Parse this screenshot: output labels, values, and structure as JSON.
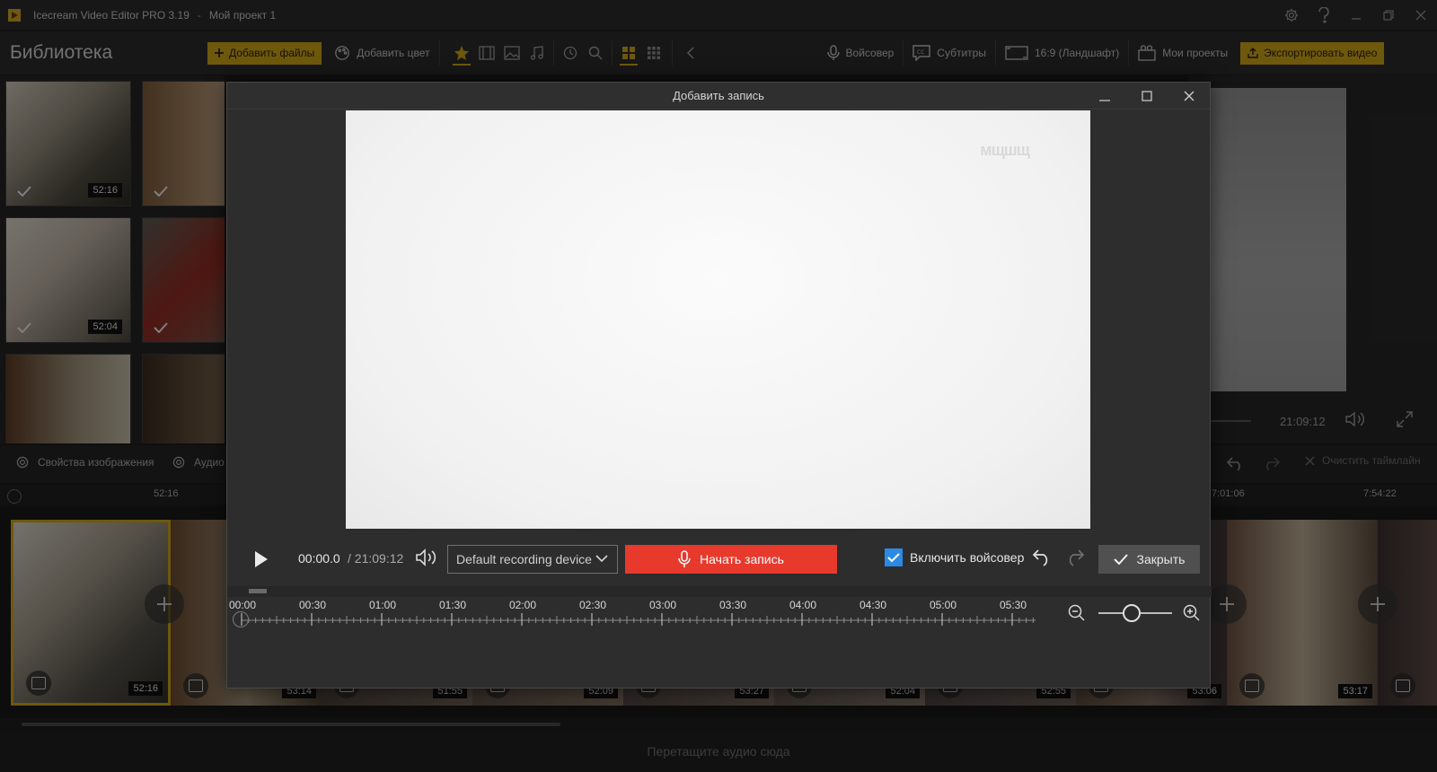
{
  "titlebar": {
    "app": "Icecream Video Editor PRO 3.19",
    "sep": "-",
    "project": "Мой проект 1"
  },
  "toolbar": {
    "library_title": "Библиотека",
    "add_files": "Добавить файлы",
    "add_color": "Добавить цвет",
    "voiceover": "Войсовер",
    "subtitles": "Субтитры",
    "aspect": "16:9 (Ландшафт)",
    "my_projects": "Мои проекты",
    "export": "Экспортировать видео"
  },
  "library": {
    "thumbs": [
      {
        "duration": "52:16"
      },
      {
        "duration": "52:04"
      }
    ]
  },
  "preview": {
    "time": "21:09:12"
  },
  "props": {
    "image_props": "Свойства изображения",
    "audio": "Аудио",
    "clear_timeline": "Очистить таймлайн"
  },
  "timeline": {
    "ruler": [
      "52:16",
      "7:01:06",
      "7:54:22"
    ],
    "clips": [
      "52:16",
      "53:14",
      "51:55",
      "52:09",
      "53:27",
      "52:04",
      "52:55",
      "53:06",
      "53:17"
    ],
    "audio_drop": "Перетащите аудио сюда"
  },
  "modal": {
    "title": "Добавить запись",
    "watermark": "мщшщ",
    "time_current": "00:00.0",
    "time_total": "/ 21:09:12",
    "device": "Default recording device",
    "record_label": "Начать запись",
    "voiceover_label": "Включить войсовер",
    "voiceover_checked": true,
    "close_label": "Закрыть",
    "ruler": [
      "00:00",
      "00:30",
      "01:00",
      "01:30",
      "02:00",
      "02:30",
      "03:00",
      "03:30",
      "04:00",
      "04:30",
      "05:00",
      "05:30"
    ]
  },
  "colors": {
    "accent": "#c8a117",
    "record": "#e8392d",
    "checkbox": "#2b8ae6"
  }
}
